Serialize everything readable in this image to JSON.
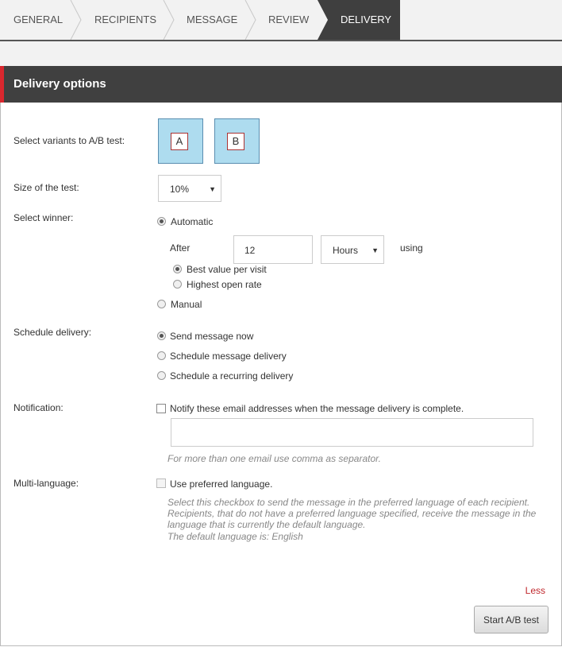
{
  "wizard": {
    "tabs": [
      {
        "label": "GENERAL"
      },
      {
        "label": "RECIPIENTS"
      },
      {
        "label": "MESSAGE"
      },
      {
        "label": "REVIEW"
      },
      {
        "label": "DELIVERY",
        "active": true
      }
    ]
  },
  "header": {
    "title": "Delivery options",
    "accent_color": "#d9272e"
  },
  "form": {
    "variants_label": "Select variants to A/B test:",
    "variants": [
      "A",
      "B"
    ],
    "size_label": "Size of the test:",
    "size_value": "10%",
    "winner_label": "Select winner:",
    "automatic_label": "Automatic",
    "after_label": "After",
    "after_value": "12",
    "unit_value": "Hours",
    "using_label": "using",
    "best_value_label": "Best value per visit",
    "highest_open_label": "Highest open rate",
    "manual_label": "Manual",
    "schedule_label": "Schedule delivery:",
    "send_now_label": "Send message now",
    "schedule_msg_label": "Schedule message delivery",
    "recurring_label": "Schedule a recurring delivery",
    "notification_label": "Notification:",
    "notify_label": "Notify these email addresses when the message delivery is complete.",
    "notify_hint": "For more than one email use comma as separator.",
    "multilang_label": "Multi-language:",
    "preferred_label": "Use preferred language.",
    "multilang_hint_1": "Select this checkbox to send the message in the preferred language of each recipient.",
    "multilang_hint_2": "Recipients, that do not have a preferred language specified, receive the message in the",
    "multilang_hint_3": "language that is currently the default language.",
    "multilang_hint_4": "The default language is: English"
  },
  "footer": {
    "less_label": "Less",
    "start_button": "Start A/B test"
  }
}
